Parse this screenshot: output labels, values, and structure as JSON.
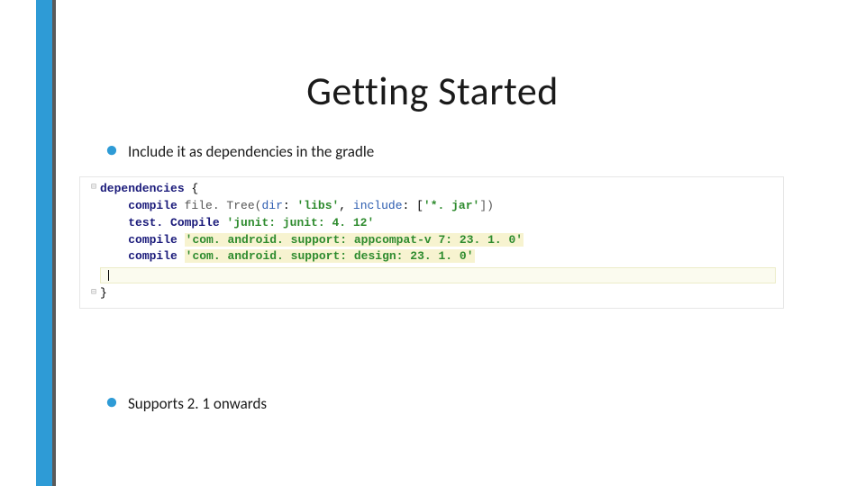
{
  "title": "Getting Started",
  "bullets": {
    "b1": "Include it as dependencies in the gradle",
    "b2": "Supports 2. 1 onwards"
  },
  "code": {
    "l1_kw": "dependencies",
    "l1_brace": " {",
    "l2_kw": "compile",
    "l2_fn": " file. Tree",
    "l2_open": "(",
    "l2_k1": "dir",
    "l2_c1": ": ",
    "l2_v1": "'libs'",
    "l2_sep": ", ",
    "l2_k2": "include",
    "l2_c2": ": [",
    "l2_v2": "'*. jar'",
    "l2_close": "])",
    "l3_kw": "test. Compile ",
    "l3_v": "'junit: junit: 4. 12'",
    "l4_kw": "compile ",
    "l4_v": "'com. android. support: appcompat-v 7: 23. 1. 0'",
    "l5_kw": "compile ",
    "l5_v": "'com. android. support: design: 23. 1. 0'",
    "l6_brace": "}"
  }
}
